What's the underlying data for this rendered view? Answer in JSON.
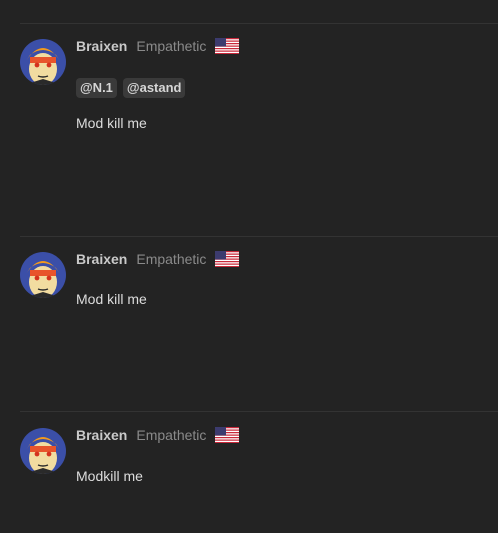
{
  "posts": [
    {
      "username": "Braixen",
      "user_title": "Empathetic",
      "flag_icon": "us-flag-icon",
      "mentions": [
        "@N.1",
        "@astand"
      ],
      "message": "Mod kill me"
    },
    {
      "username": "Braixen",
      "user_title": "Empathetic",
      "flag_icon": "us-flag-icon",
      "message": "Mod kill me"
    },
    {
      "username": "Braixen",
      "user_title": "Empathetic",
      "flag_icon": "us-flag-icon",
      "message": "Modkill me"
    }
  ],
  "colors": {
    "background": "#232323",
    "username": "#c9c9c9",
    "user_title": "#8a8a8a",
    "message": "#dcdcdc",
    "mention_bg": "#3a3a3a"
  }
}
